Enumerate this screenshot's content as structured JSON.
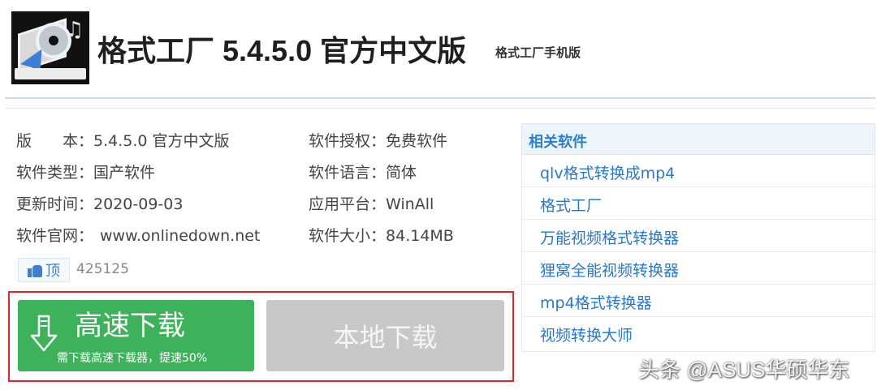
{
  "header": {
    "title": "格式工厂 5.4.5.0 官方中文版",
    "subtitle_link": "格式工厂手机版"
  },
  "info": {
    "version": {
      "label": "版　　本：",
      "value": "5.4.5.0 官方中文版"
    },
    "license": {
      "label": "软件授权：",
      "value": "免费软件"
    },
    "type": {
      "label": "软件类型：",
      "value": "国产软件"
    },
    "language": {
      "label": "软件语言：",
      "value": "简体"
    },
    "updated": {
      "label": "更新时间：",
      "value": "2020-09-03"
    },
    "platform": {
      "label": "应用平台：",
      "value": "WinAll"
    },
    "website": {
      "label": "软件官网：",
      "value": "www.onlinedown.net"
    },
    "size": {
      "label": "软件大小：",
      "value": "84.14MB"
    }
  },
  "like": {
    "label": "顶",
    "count": "425125"
  },
  "download": {
    "fast_label": "高速下载",
    "fast_sublabel": "需下载高速下载器，提速50%",
    "local_label": "本地下载"
  },
  "sidebar": {
    "header": "相关软件",
    "items": [
      {
        "label": "qlv格式转换成mp4"
      },
      {
        "label": "格式工厂"
      },
      {
        "label": "万能视频格式转换器"
      },
      {
        "label": "狸窝全能视频转换器"
      },
      {
        "label": "mp4格式转换器"
      },
      {
        "label": "视频转换大师"
      }
    ]
  },
  "watermark": "头条 @ASUS华硕华东",
  "colors": {
    "download_green": "#3db25a",
    "download_gray": "#c8c8c8",
    "highlight_red": "#e0242a",
    "link_blue": "#2a78c9"
  }
}
